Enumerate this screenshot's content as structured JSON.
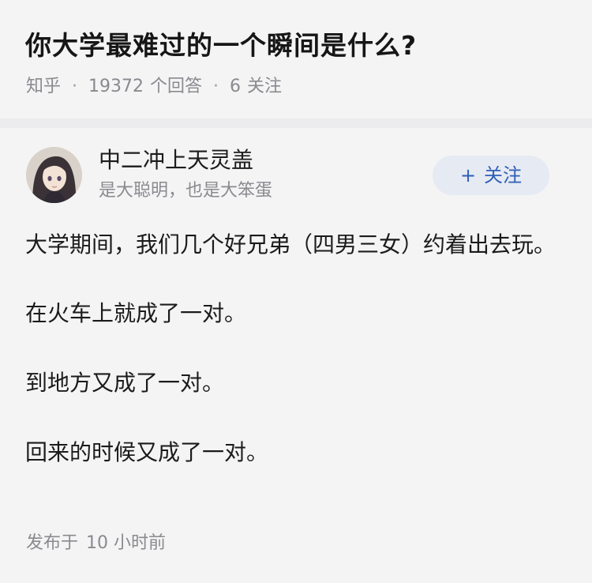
{
  "question": {
    "title": "你大学最难过的一个瞬间是什么?",
    "source": "知乎",
    "answer_count": "19372",
    "answer_label": "个回答",
    "follower_count": "6",
    "follower_label": "关注",
    "separator": "·"
  },
  "author": {
    "name": "中二冲上天灵盖",
    "headline": "是大聪明，也是大笨蛋",
    "follow_label": "关注",
    "follow_prefix": "+"
  },
  "answer": {
    "paragraphs": [
      "大学期间，我们几个好兄弟（四男三女）约着出去玩。",
      "在火车上就成了一对。",
      "到地方又成了一对。",
      "回来的时候又成了一对。"
    ],
    "published_label": "发布于",
    "published_time": "10 小时前"
  }
}
